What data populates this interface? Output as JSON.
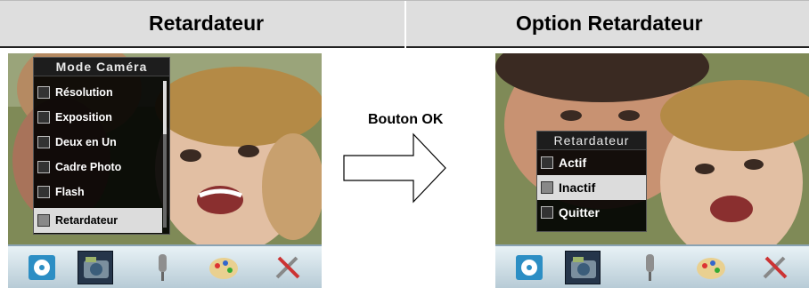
{
  "header": {
    "left_title": "Retardateur",
    "right_title": "Option Retardateur"
  },
  "left_screen": {
    "menu_title": "Mode Caméra",
    "items": [
      "Résolution",
      "Exposition",
      "Deux en Un",
      "Cadre Photo",
      "Flash",
      "Retardateur"
    ],
    "selected_index": 5
  },
  "arrow": {
    "label": "Bouton OK"
  },
  "right_screen": {
    "menu_title": "Retardateur",
    "items": [
      "Actif",
      "Inactif",
      "Quitter"
    ],
    "selected_index": 1
  },
  "toolbar": {
    "icons": [
      "film-reel-icon",
      "camera-icon",
      "microphone-icon",
      "palette-icon",
      "tools-icon"
    ],
    "selected_index": 1
  },
  "colors": {
    "header_bg": "#dedede",
    "menu_bg": "#000000",
    "selected_bg": "#dcdcdc",
    "toolbar_bg": "#c9dbe4"
  }
}
